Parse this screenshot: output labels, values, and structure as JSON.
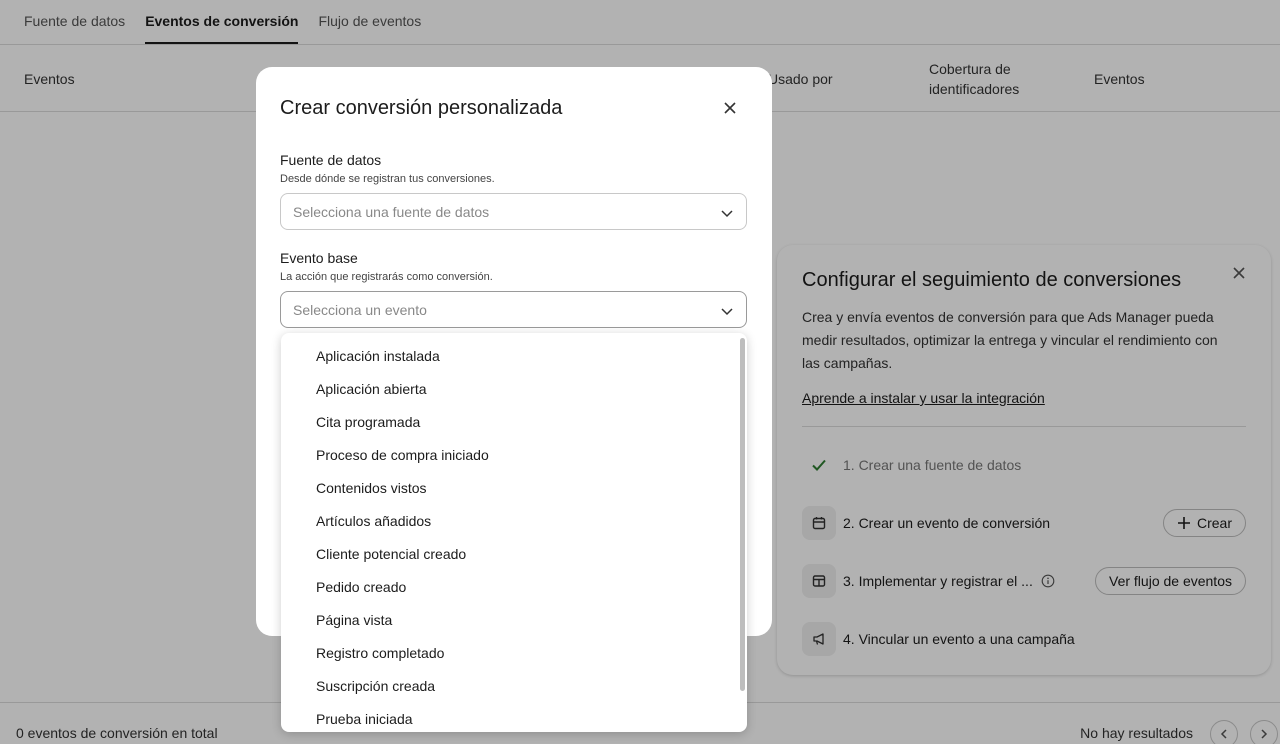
{
  "tabs": [
    {
      "label": "Fuente de datos",
      "active": false
    },
    {
      "label": "Eventos de conversión",
      "active": true
    },
    {
      "label": "Flujo de eventos",
      "active": false
    }
  ],
  "table": {
    "columns": [
      "Eventos",
      "Usado por",
      "Cobertura de identificadores",
      "Eventos"
    ]
  },
  "footer": {
    "total": "0 eventos de conversión en total",
    "no_results": "No hay resultados"
  },
  "setup_card": {
    "title": "Configurar el seguimiento de conversiones",
    "description": "Crea y envía eventos de conversión para que Ads Manager pueda medir resultados, optimizar la entrega y vincular el rendimiento con las campañas.",
    "link": "Aprende a instalar y usar la integración",
    "steps": [
      {
        "label": "1. Crear una fuente de datos",
        "icon": "check-icon",
        "done": true
      },
      {
        "label": "2. Crear un evento de conversión",
        "icon": "calendar-icon",
        "button": "Crear"
      },
      {
        "label": "3. Implementar y registrar el ...",
        "icon": "layout-icon",
        "button": "Ver flujo de eventos"
      },
      {
        "label": "4. Vincular un evento a una campaña",
        "icon": "megaphone-icon"
      }
    ]
  },
  "modal": {
    "title": "Crear conversión personalizada",
    "data_source": {
      "label": "Fuente de datos",
      "help": "Desde dónde se registran tus conversiones.",
      "placeholder": "Selecciona una fuente de datos"
    },
    "base_event": {
      "label": "Evento base",
      "help": "La acción que registrarás como conversión.",
      "placeholder": "Selecciona un evento"
    }
  },
  "dropdown_options": [
    "Aplicación instalada",
    "Aplicación abierta",
    "Cita programada",
    "Proceso de compra iniciado",
    "Contenidos vistos",
    "Artículos añadidos",
    "Cliente potencial creado",
    "Pedido creado",
    "Página vista",
    "Registro completado",
    "Suscripción creada",
    "Prueba iniciada"
  ],
  "colors": {
    "overlay": "#000000",
    "check": "#2e7d32",
    "text": "#1c1c1c"
  }
}
